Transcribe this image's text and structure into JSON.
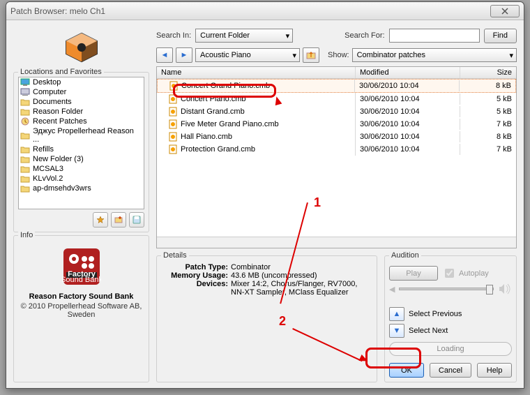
{
  "window": {
    "title": "Patch Browser: melo Ch1"
  },
  "search": {
    "search_in_label": "Search In:",
    "search_in_value": "Current Folder",
    "search_for_label": "Search For:",
    "search_for_value": "",
    "find_label": "Find"
  },
  "nav": {
    "path_value": "Acoustic Piano",
    "show_label": "Show:",
    "show_value": "Combinator patches"
  },
  "locations": {
    "title": "Locations and Favorites",
    "items": [
      {
        "label": "Desktop",
        "icon": "desktop"
      },
      {
        "label": "Computer",
        "icon": "computer"
      },
      {
        "label": "Documents",
        "icon": "folder"
      },
      {
        "label": "Reason Folder",
        "icon": "folder"
      },
      {
        "label": "Recent Patches",
        "icon": "recent"
      },
      {
        "label": "Эджус  Propellerhead Reason ...",
        "icon": "folder"
      },
      {
        "label": "Refills",
        "icon": "folder"
      },
      {
        "label": "New Folder (3)",
        "icon": "folder"
      },
      {
        "label": "MCSAL3",
        "icon": "folder"
      },
      {
        "label": "KLvVol.2",
        "icon": "folder"
      },
      {
        "label": "ap-dmsehdv3wrs",
        "icon": "folder"
      }
    ]
  },
  "filelist": {
    "headers": {
      "name": "Name",
      "modified": "Modified",
      "size": "Size"
    },
    "rows": [
      {
        "name": "Concert Grand Piano.cmb",
        "modified": "30/06/2010 10:04",
        "size": "8 kB",
        "selected": true
      },
      {
        "name": "Concert Piano.cmb",
        "modified": "30/06/2010 10:04",
        "size": "5 kB"
      },
      {
        "name": "Distant Grand.cmb",
        "modified": "30/06/2010 10:04",
        "size": "5 kB"
      },
      {
        "name": "Five Meter Grand Piano.cmb",
        "modified": "30/06/2010 10:04",
        "size": "7 kB"
      },
      {
        "name": "Hall Piano.cmb",
        "modified": "30/06/2010 10:04",
        "size": "8 kB"
      },
      {
        "name": "Protection Grand.cmb",
        "modified": "30/06/2010 10:04",
        "size": "7 kB"
      }
    ]
  },
  "info": {
    "title": "Info",
    "name": "Reason Factory Sound Bank",
    "copyright": "© 2010 Propellerhead Software AB, Sweden"
  },
  "details": {
    "title": "Details",
    "patch_type_k": "Patch Type:",
    "patch_type_v": "Combinator",
    "mem_k": "Memory Usage:",
    "mem_v": "43.6 MB (uncompressed)",
    "dev_k": "Devices:",
    "dev_v1": "Mixer 14:2, Chorus/Flanger, RV7000,",
    "dev_v2": "NN-XT Sampler, MClass Equalizer"
  },
  "audition": {
    "title": "Audition",
    "play": "Play",
    "autoplay": "Autoplay",
    "select_prev": "Select Previous",
    "select_next": "Select Next",
    "loading": "Loading"
  },
  "buttons": {
    "ok": "OK",
    "cancel": "Cancel",
    "help": "Help"
  },
  "annotations": {
    "one": "1",
    "two": "2"
  },
  "colors": {
    "accent": "#e08040",
    "annot": "#d00020"
  }
}
